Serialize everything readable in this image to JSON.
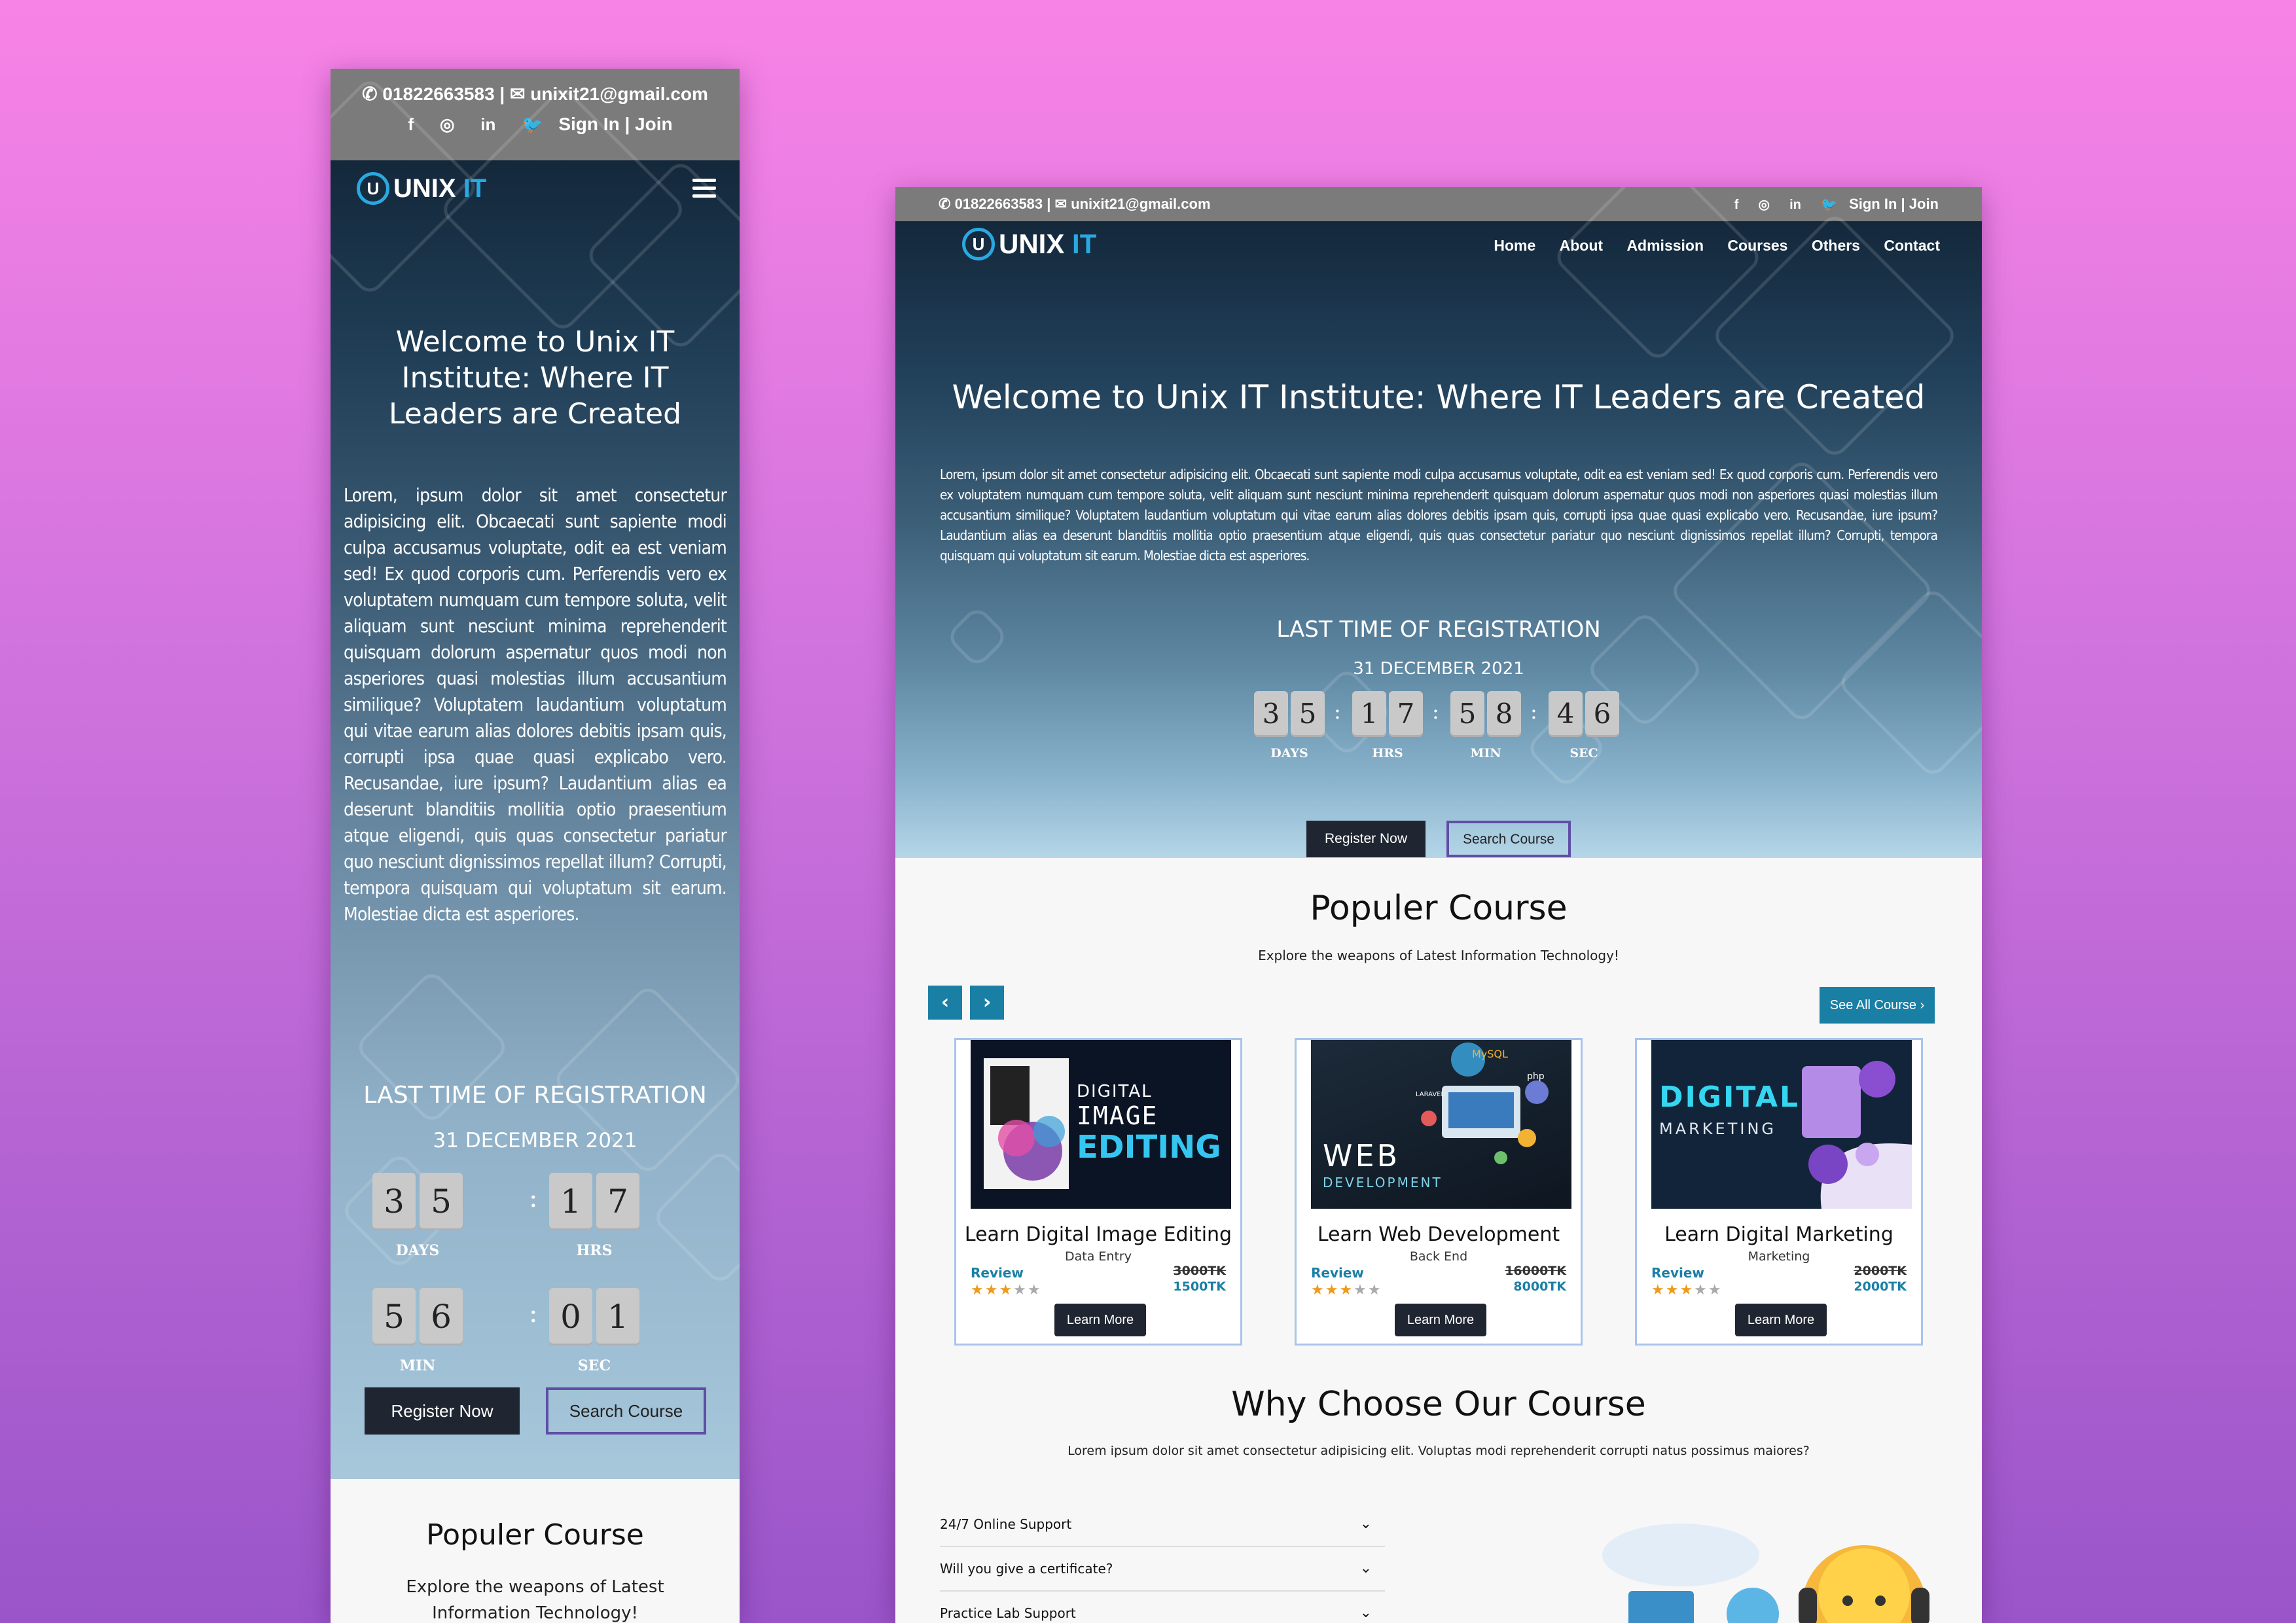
{
  "contact": {
    "phone": "01822663583",
    "separator": "|",
    "email": "unixit21@gmail.com",
    "auth": "Sign In | Join",
    "social": [
      "f",
      "◎",
      "in",
      "🐦"
    ]
  },
  "brand": {
    "name": "UNIX",
    "suffix": "IT",
    "mark": "U"
  },
  "nav": [
    "Home",
    "About",
    "Admission",
    "Courses",
    "Others",
    "Contact"
  ],
  "hero": {
    "title": "Welcome to Unix IT Institute: Where IT Leaders are Created",
    "paragraph": "Lorem, ipsum dolor sit amet consectetur adipisicing elit. Obcaecati sunt sapiente modi culpa accusamus voluptate, odit ea est veniam sed! Ex quod corporis cum. Perferendis vero ex voluptatem numquam cum tempore soluta, velit aliquam sunt nesciunt minima reprehenderit quisquam dolorum aspernatur quos modi non asperiores quasi molestias illum accusantium similique? Voluptatem laudantium voluptatum qui vitae earum alias dolores debitis ipsam quis, corrupti ipsa quae quasi explicabo vero. Recusandae, iure ipsum? Laudantium alias ea deserunt blanditiis mollitia optio praesentium atque eligendi, quis quas consectetur pariatur quo nesciunt dignissimos repellat illum? Corrupti, tempora quisquam qui voluptatum sit earum. Molestiae dicta est asperiores.",
    "registration_title": "LAST TIME OF REGISTRATION",
    "registration_date": "31 DECEMBER 2021",
    "register_button": "Register Now",
    "search_button": "Search Course"
  },
  "countdown_mobile": {
    "days": [
      "3",
      "5"
    ],
    "hrs": [
      "1",
      "7"
    ],
    "min": [
      "5",
      "6"
    ],
    "sec": [
      "0",
      "1"
    ]
  },
  "countdown_desktop": {
    "days": [
      "3",
      "5"
    ],
    "hrs": [
      "1",
      "7"
    ],
    "min": [
      "5",
      "8"
    ],
    "sec": [
      "4",
      "6"
    ]
  },
  "countdown_labels": {
    "days": "DAYS",
    "hrs": "HRS",
    "min": "MIN",
    "sec": "SEC",
    "colon": ":"
  },
  "popular": {
    "title": "Populer Course",
    "subtitle": "Explore the weapons of Latest Information Technology!",
    "see_all": "See All Course ›",
    "prev": "‹",
    "next": "›"
  },
  "courses": [
    {
      "title": "Learn Digital Image Editing",
      "category": "Data Entry",
      "review_label": "Review",
      "rating": 3,
      "max_rating": 5,
      "old_price": "3000TK",
      "new_price": "1500TK",
      "button": "Learn More",
      "image_line1": "DIGITAL",
      "image_line2": "IMAGE",
      "image_line3": "EDITING"
    },
    {
      "title": "Learn Web Development",
      "category": "Back End",
      "review_label": "Review",
      "rating": 3,
      "max_rating": 5,
      "old_price": "16000TK",
      "new_price": "8000TK",
      "button": "Learn More",
      "image_line1": "WEB",
      "image_line2": "DEVELOPMENT",
      "image_tags": [
        "MySQL",
        "php",
        "LARAVEL"
      ]
    },
    {
      "title": "Learn Digital Marketing",
      "category": "Marketing",
      "review_label": "Review",
      "rating": 3,
      "max_rating": 5,
      "old_price": "2000TK",
      "new_price": "2000TK",
      "button": "Learn More",
      "image_line1": "DIGITAL",
      "image_line2": "MARKETING"
    }
  ],
  "why": {
    "title": "Why Choose Our Course",
    "subtitle": "Lorem ipsum dolor sit amet consectetur adipisicing elit. Voluptas modi reprehenderit corrupti natus possimus maiores?",
    "faq": [
      "24/7 Online Support",
      "Will you give a certificate?",
      "Practice Lab Support"
    ]
  },
  "colors": {
    "accent": "#1a7fa5",
    "logo_blue": "#29a9e1",
    "dark_button": "#202631",
    "outline": "#5e4ea5",
    "star": "#f09a1a"
  }
}
